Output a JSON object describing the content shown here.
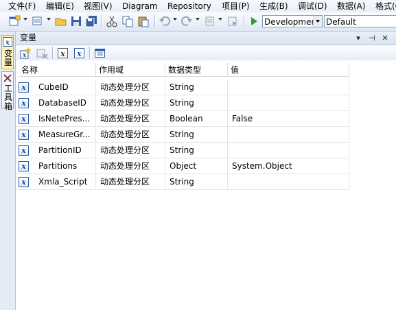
{
  "menubar": {
    "items": [
      "文件(F)",
      "编辑(E)",
      "视图(V)",
      "Diagram",
      "Repository",
      "项目(P)",
      "生成(B)",
      "调试(D)",
      "数据(A)",
      "格式(O)"
    ]
  },
  "toolbar": {
    "configuration": "Developmer",
    "platform": "Default"
  },
  "sidebar": {
    "variables_tab": "变量",
    "toolbox_tab": "工具箱"
  },
  "panel": {
    "title": "变量"
  },
  "grid": {
    "headers": [
      "名称",
      "作用域",
      "数据类型",
      "值"
    ],
    "rows": [
      {
        "name": "CubeID",
        "scope": "动态处理分区",
        "type": "String",
        "value": ""
      },
      {
        "name": "DatabaseID",
        "scope": "动态处理分区",
        "type": "String",
        "value": ""
      },
      {
        "name": "IsNetePres...",
        "scope": "动态处理分区",
        "type": "Boolean",
        "value": "False"
      },
      {
        "name": "MeasureGr...",
        "scope": "动态处理分区",
        "type": "String",
        "value": ""
      },
      {
        "name": "PartitionID",
        "scope": "动态处理分区",
        "type": "String",
        "value": ""
      },
      {
        "name": "Partitions",
        "scope": "动态处理分区",
        "type": "Object",
        "value": "System.Object"
      },
      {
        "name": "Xmla_Script",
        "scope": "动态处理分区",
        "type": "String",
        "value": ""
      }
    ]
  },
  "colors": {
    "accent": "#2b5ca8",
    "chrome": "#dfe7f4"
  }
}
